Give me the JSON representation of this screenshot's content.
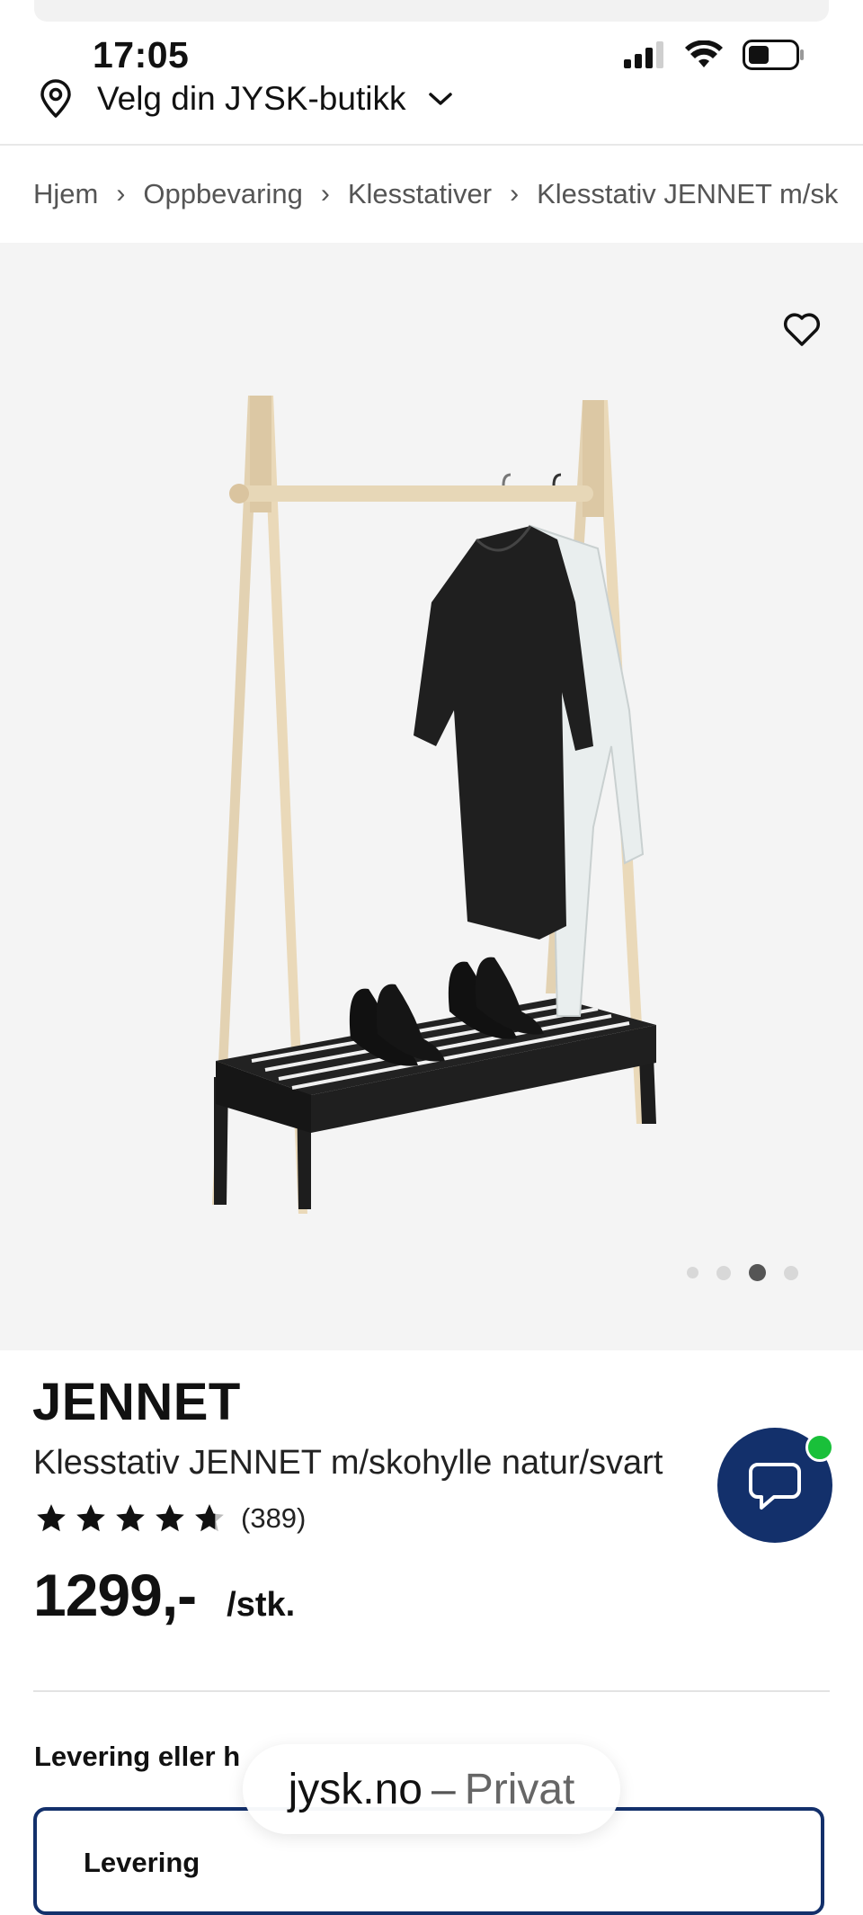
{
  "status_bar": {
    "time": "17:05",
    "signal_icon": "cellular-signal-icon",
    "wifi_icon": "wifi-icon",
    "battery_icon": "battery-icon"
  },
  "store_selector": {
    "label": "Velg din JYSK-butikk",
    "icon": "location-pin-icon",
    "chevron": "chevron-down-icon"
  },
  "breadcrumb": [
    "Hjem",
    "Oppbevaring",
    "Klesstativer",
    "Klesstativ JENNET m/sk"
  ],
  "gallery": {
    "favorite_icon": "heart-outline-icon",
    "image_count": 4,
    "active_index": 2
  },
  "product": {
    "brand": "JENNET",
    "name": "Klesstativ JENNET m/skohylle natur/svart",
    "rating": 4.5,
    "review_count": "(389)",
    "price": "1299,-",
    "unit": "/stk."
  },
  "delivery": {
    "heading": "Levering eller h",
    "option_label": "Levering"
  },
  "chat": {
    "icon": "chat-bubble-icon",
    "status_color": "#19c03a",
    "button_color": "#13306b"
  },
  "browser": {
    "host": "jysk.no",
    "separator": "–",
    "mode": "Privat"
  }
}
